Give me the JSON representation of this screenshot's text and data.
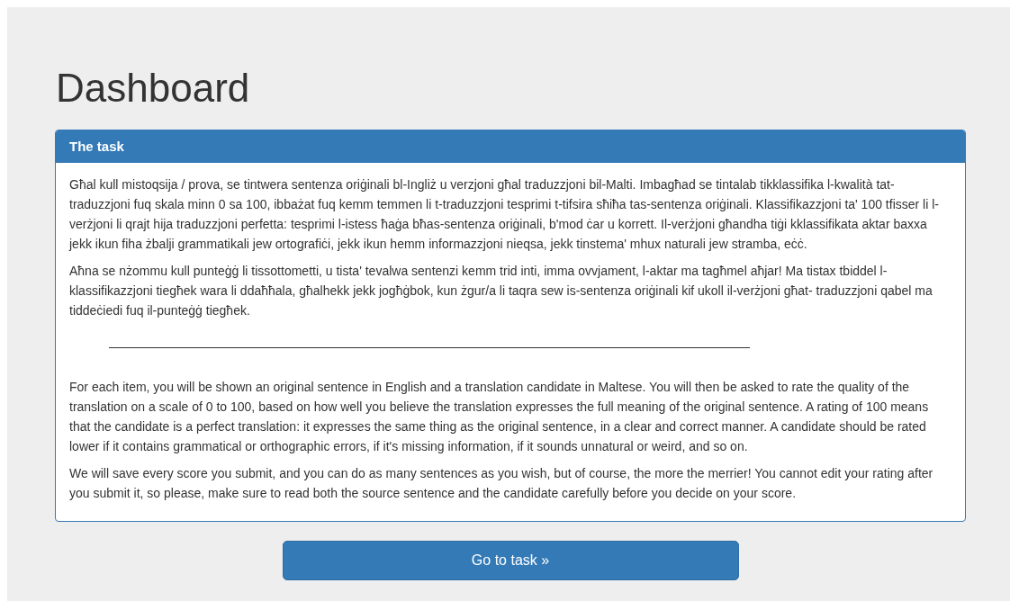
{
  "title": "Dashboard",
  "panel": {
    "heading": "The task",
    "paragraphs_top": [
      "Għal kull mistoqsija / prova, se tintwera sentenza oriġinali bl-Ingliż u verzjoni għal traduzzjoni bil-Malti. Imbagħad se tintalab tikklassifika l-kwalità tat-traduzzjoni fuq skala minn 0 sa 100, ibbażat fuq kemm temmen li t-traduzzjoni tesprimi t-tifsira sħiħa tas-sentenza oriġinali. Klassifikazzjoni ta' 100 tfisser li l-verżjoni li qrajt hija traduzzjoni perfetta: tesprimi l-istess ħaġa bħas-sentenza oriġinali, b'mod ċar u korrett. Il-verżjoni għandha tiġi kklassifikata aktar baxxa jekk ikun fiha żbalji grammatikali jew ortografiċi, jekk ikun hemm informazzjoni nieqsa, jekk tinstema' mhux naturali jew stramba, eċċ.",
      "Aħna se nżommu kull punteġġ li tissottometti, u tista' tevalwa sentenzi kemm trid inti, imma ovvjament, l-aktar ma tagħmel aħjar! Ma tistax tbiddel l-klassifikazzjoni tiegħek wara li ddaħħala, għalhekk jekk jogħġbok, kun żgur/a li taqra sew is-sentenza oriġinali kif ukoll il-verżjoni għat- traduzzjoni qabel ma tiddeċiedi fuq il-punteġġ tiegħek."
    ],
    "paragraphs_bottom": [
      "For each item, you will be shown an original sentence in English and a translation candidate in Maltese. You will then be asked to rate the quality of the translation on a scale of 0 to 100, based on how well you believe the translation expresses the full meaning of the original sentence. A rating of 100 means that the candidate is a perfect translation: it expresses the same thing as the original sentence, in a clear and correct manner. A candidate should be rated lower if it contains grammatical or orthographic errors, if it's missing information, if it sounds unnatural or weird, and so on.",
      "We will save every score you submit, and you can do as many sentences as you wish, but of course, the more the merrier! You cannot edit your rating after you submit it, so please, make sure to read both the source sentence and the candidate carefully before you decide on your score."
    ]
  },
  "button": "Go to task »"
}
